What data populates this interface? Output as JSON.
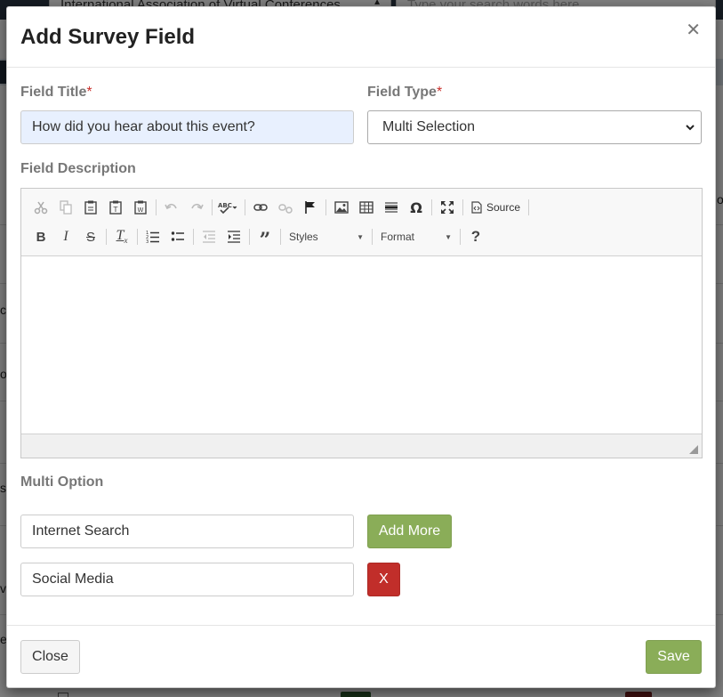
{
  "background": {
    "org_select_value": "International Association of Virtual Conferences",
    "search_placeholder": "Type your search words here",
    "row_fragments_left": [
      "c",
      "o",
      "s",
      "v",
      "er"
    ],
    "row_fragment_right": "ov"
  },
  "modal": {
    "title": "Add Survey Field",
    "close_icon": "close-icon",
    "field_title": {
      "label": "Field Title",
      "required_mark": "*",
      "value": "How did you hear about this event?"
    },
    "field_type": {
      "label": "Field Type",
      "required_mark": "*",
      "selected": "Multi Selection"
    },
    "field_description": {
      "label": "Field Description",
      "toolbar": {
        "row1": [
          "cut-icon",
          "copy-icon",
          "paste-icon",
          "paste-text-icon",
          "paste-word-icon",
          "undo-icon",
          "redo-icon",
          "spellcheck-icon",
          "link-icon",
          "unlink-icon",
          "anchor-icon",
          "image-icon",
          "table-icon",
          "horizontal-rule-icon",
          "special-char-icon",
          "maximize-icon",
          "source-icon"
        ],
        "source_label": "Source",
        "row2": [
          "bold-icon",
          "italic-icon",
          "strikethrough-icon",
          "remove-format-icon",
          "numbered-list-icon",
          "bulleted-list-icon",
          "outdent-icon",
          "indent-icon",
          "blockquote-icon",
          "help-icon"
        ],
        "styles_label": "Styles",
        "format_label": "Format"
      }
    },
    "multi_option": {
      "label": "Multi Option",
      "options": [
        "Internet Search",
        "Social Media"
      ],
      "add_more_label": "Add More",
      "remove_label": "X"
    },
    "footer": {
      "close_label": "Close",
      "save_label": "Save"
    },
    "colors": {
      "accent_green": "#8aad58",
      "danger_red": "#c12e2a",
      "required_red": "#c9302c"
    }
  }
}
